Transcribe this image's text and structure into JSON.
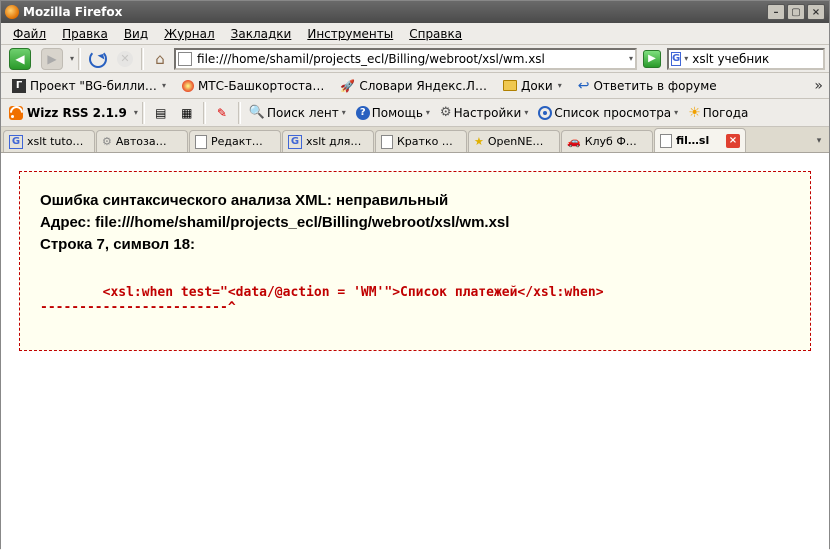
{
  "window": {
    "title": "Mozilla Firefox"
  },
  "menu": {
    "file": "Файл",
    "edit": "Правка",
    "view": "Вид",
    "journal": "Журнал",
    "bookmarks": "Закладки",
    "tools": "Инструменты",
    "help": "Справка"
  },
  "nav": {
    "url": "file:///home/shamil/projects_ecl/Billing/webroot/xsl/wm.xsl",
    "search_engine_badge": "G",
    "search_value": "xslt учебник"
  },
  "bookmarks": {
    "items": [
      {
        "label": "Проект \"BG-билли…"
      },
      {
        "label": "МТС-Башкортоста…"
      },
      {
        "label": "Словари Яндекс.Л…"
      },
      {
        "label": "Доки"
      },
      {
        "label": "Ответить в форуме"
      }
    ],
    "overflow": "»"
  },
  "rss": {
    "brand": "Wizz RSS 2.1.9",
    "find_feeds": "Поиск лент",
    "help": "Помощь",
    "settings": "Настройки",
    "watchlist": "Список просмотра",
    "weather": "Погода"
  },
  "tabs": {
    "items": [
      {
        "label": "xslt tuto…"
      },
      {
        "label": "Автоза…"
      },
      {
        "label": "Редакт…"
      },
      {
        "label": "xslt для…"
      },
      {
        "label": "Кратко …"
      },
      {
        "label": "OpenNE…"
      },
      {
        "label": "Клуб Ф…"
      },
      {
        "label": "fil…sl"
      }
    ]
  },
  "error": {
    "line1": "Ошибка синтаксического анализа XML: неправильный",
    "line2": "Адрес: file:///home/shamil/projects_ecl/Billing/webroot/xsl/wm.xsl",
    "line3": "Строка 7, символ 18:",
    "code": "        <xsl:when test=\"<data/@action = 'WM'\">Список платежей</xsl:when>",
    "caret": "------------------------^"
  }
}
